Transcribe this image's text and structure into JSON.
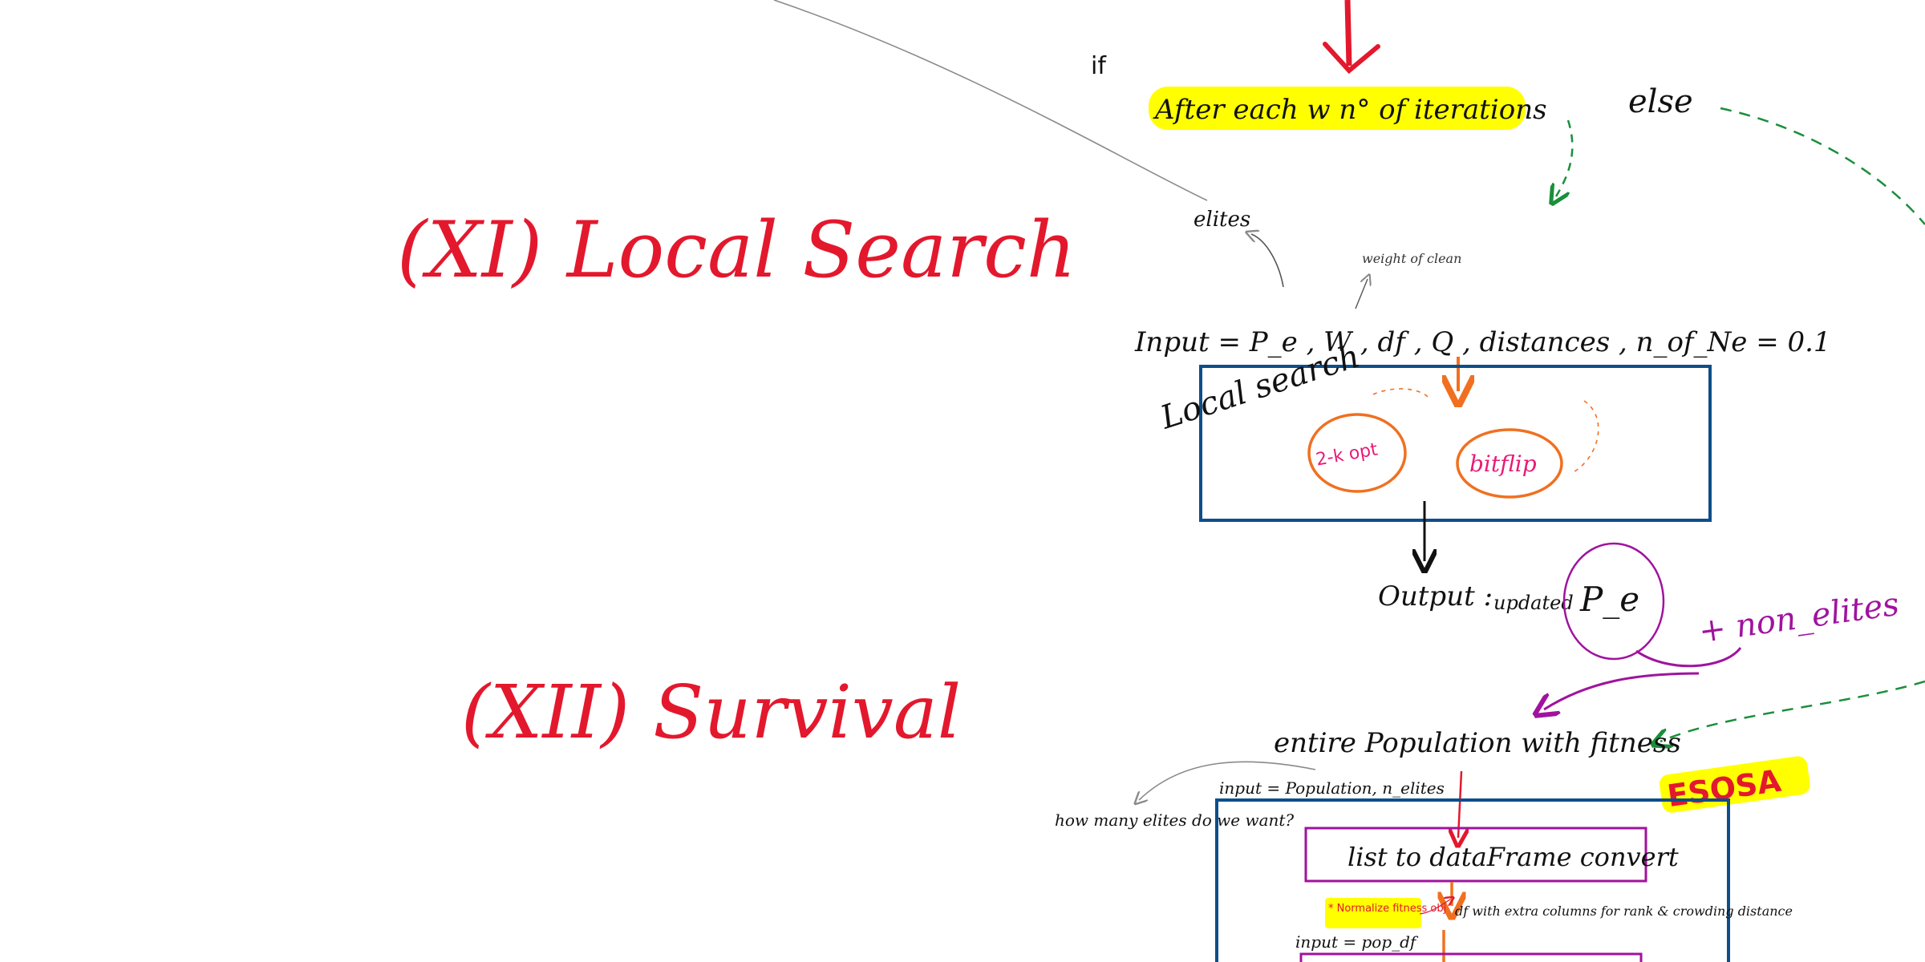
{
  "headings": {
    "local_search": "(XI) Local Search",
    "survival": "(XII) Survival"
  },
  "top": {
    "if_label": "if",
    "condition": "After each w n° of iterations",
    "else_label": "else"
  },
  "local_search": {
    "elites_note": "elites",
    "weight_note": "weight of clean",
    "input": "Input = P_e , W , df , Q , distances , n_of_Ne = 0.1",
    "box_label": "Local search",
    "methods": [
      "2-k opt",
      "bitflip"
    ],
    "output_label": "Output :",
    "output_text": "updated",
    "output_symbol": "P_e",
    "non_elites": "+ non_elites"
  },
  "survival": {
    "entry": "entire Population with fitness",
    "input": "input = Population, n_elites",
    "question": "how many elites do we want?",
    "tag": "ESOSA",
    "step1": "list to dataFrame convert",
    "normalize_note": "* Normalize fitness obj",
    "df_note": "df with extra columns for rank & crowding distance",
    "next_input": "input = pop_df"
  },
  "colors": {
    "red": "#e3182d",
    "black": "#111111",
    "orange": "#f07020",
    "magenta": "#e81b78",
    "purple": "#a0139e",
    "green": "#1a8f3a",
    "blue": "#0e4e8a",
    "highlight": "#ffff00",
    "gray": "#8a8a8a"
  }
}
